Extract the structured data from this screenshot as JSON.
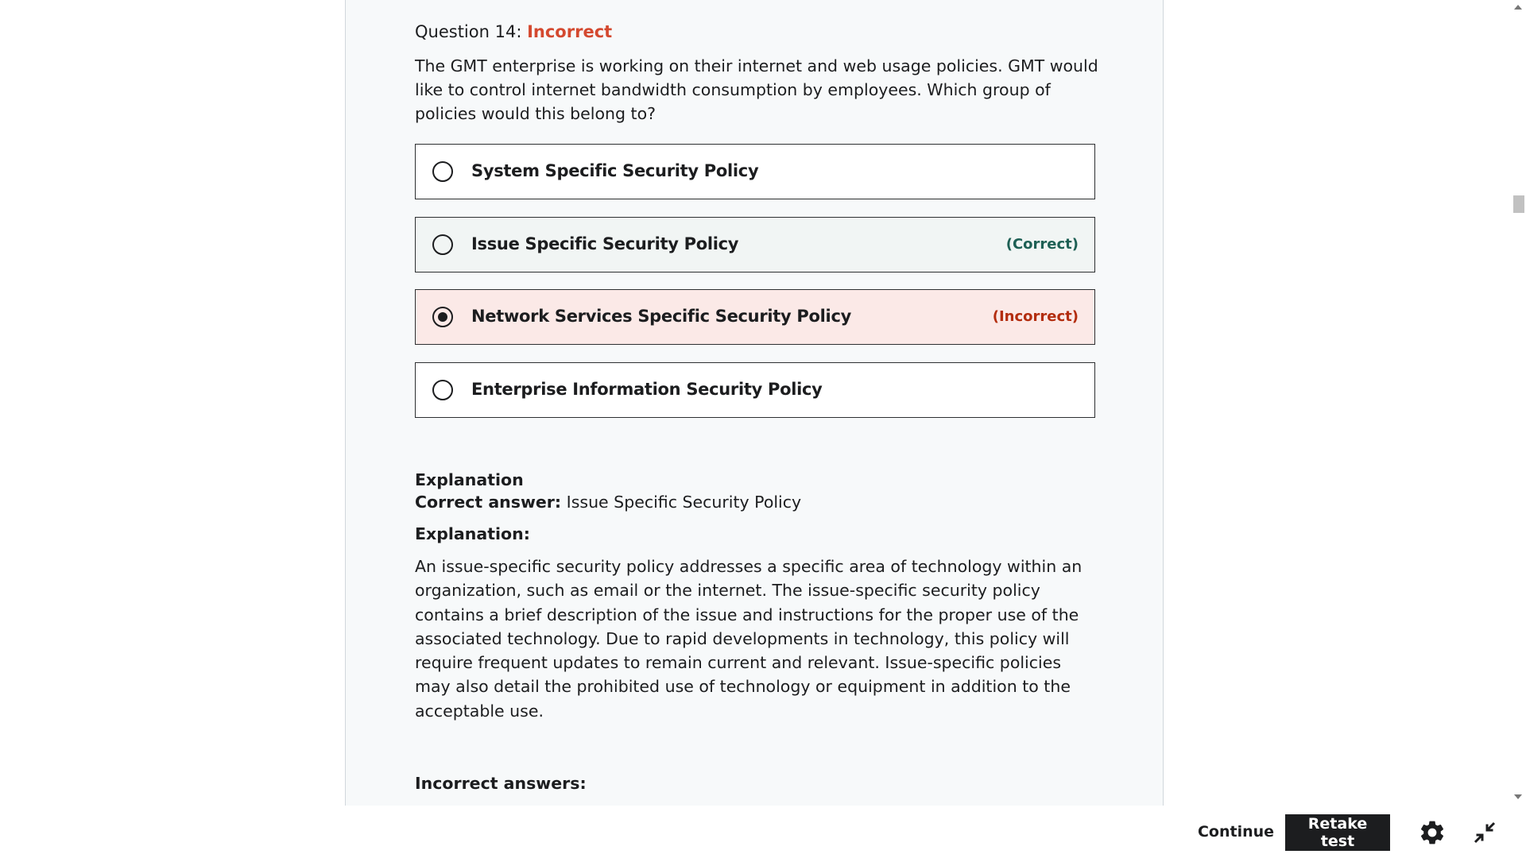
{
  "question": {
    "label": "Question 14:",
    "status": "Incorrect",
    "text": "The GMT enterprise is working on their internet and web usage policies. GMT would like to control internet bandwidth consumption by employees. Which group of policies would this belong to?"
  },
  "options": [
    {
      "label": "System Specific Security Policy",
      "tag": "",
      "selected": false
    },
    {
      "label": "Issue Specific Security Policy",
      "tag": "(Correct)",
      "selected": false
    },
    {
      "label": "Network Services Specific Security Policy",
      "tag": "(Incorrect)",
      "selected": true
    },
    {
      "label": "Enterprise Information Security Policy",
      "tag": "",
      "selected": false
    }
  ],
  "explanation": {
    "title": "Explanation",
    "correct_answer_label": "Correct answer:",
    "correct_answer_value": "Issue Specific Security Policy",
    "subtitle": "Explanation:",
    "body": "An issue-specific security policy addresses a specific area of technology within an organization, such as email or the internet. The issue-specific security policy contains a brief description of the issue and instructions for the proper use of the associated technology. Due to rapid developments in technology, this policy will require frequent updates to remain current and relevant. Issue-specific policies may also detail the prohibited use of technology or equipment in addition to the acceptable use.",
    "incorrect_answers_title": "Incorrect answers:"
  },
  "footer": {
    "continue_label": "Continue",
    "retake_label": "Retake test",
    "settings_icon": "gear-icon",
    "collapse_icon": "collapse-icon"
  },
  "colors": {
    "incorrect": "#d4492f",
    "correct_tag": "#1e6055",
    "incorrect_bg": "#fbe9e7",
    "correct_bg": "#f1f5f4"
  }
}
